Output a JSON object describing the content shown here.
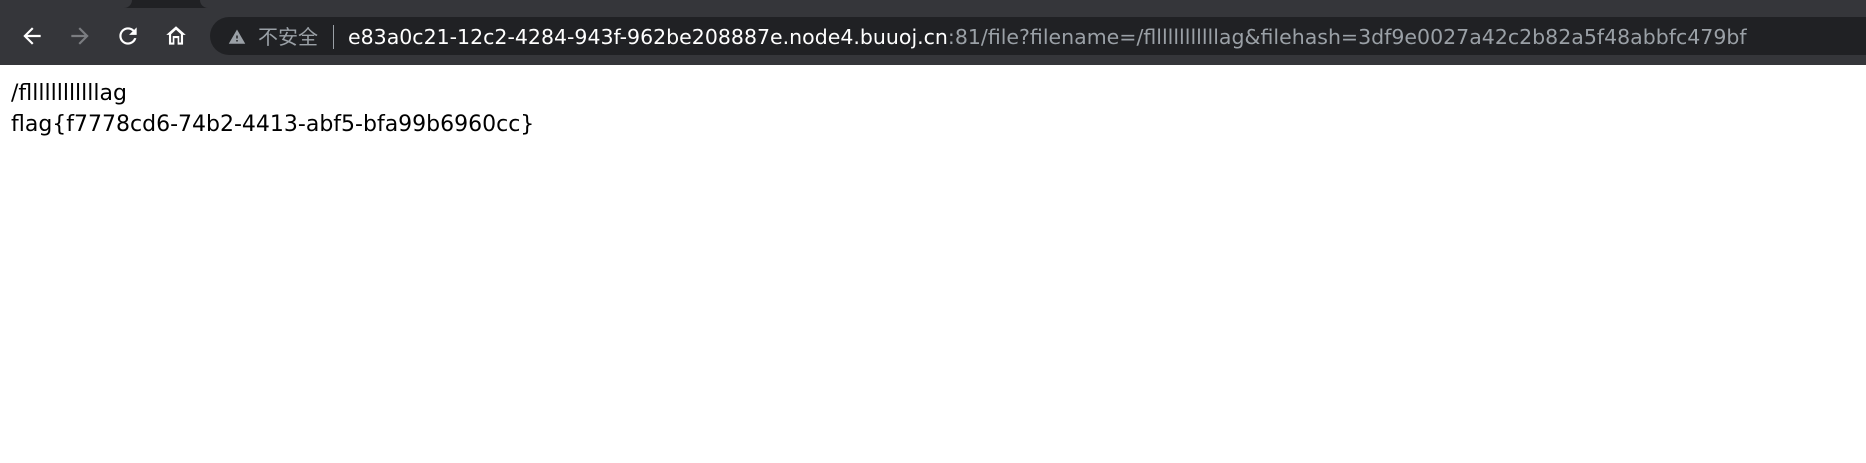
{
  "browser": {
    "security_label": "不安全",
    "url_host": "e83a0c21-12c2-4284-943f-962be208887e.node4.buuoj.cn",
    "url_rest": ":81/file?filename=/fllllllllllllag&filehash=3df9e0027a42c2b82a5f48abbfc479bf",
    "nav": {
      "back_icon": "arrow-left-icon",
      "forward_icon": "arrow-right-icon",
      "reload_icon": "reload-icon",
      "home_icon": "home-icon",
      "security_icon": "warning-triangle-icon"
    }
  },
  "page": {
    "lines": [
      "/fllllllllllllag",
      "flag{f7778cd6-74b2-4413-abf5-bfa99b6960cc}"
    ]
  }
}
